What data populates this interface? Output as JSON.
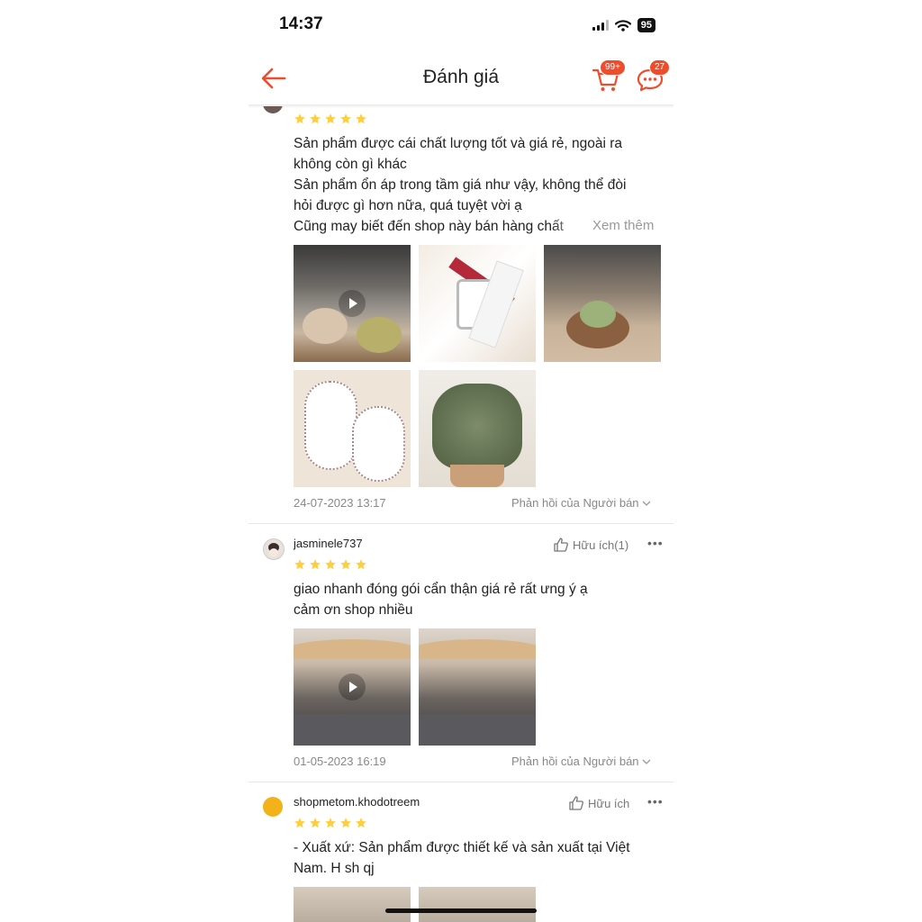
{
  "status_bar": {
    "time": "14:37",
    "battery": "95"
  },
  "header": {
    "title": "Đánh giá",
    "cart_badge": "99+",
    "chat_badge": "27"
  },
  "reviews": [
    {
      "username": "",
      "rating": 5,
      "comment_lines": [
        "Sản phẩm được cái chất lượng tốt và giá rẻ, ngoài ra",
        "không còn gì khác",
        "Sản phẩm ổn áp trong tầm giá như vậy, không thể đòi",
        "hỏi được gì hơn nữa, quá tuyệt vời ạ",
        "Cũng may biết đến shop này bán hàng chất"
      ],
      "see_more": "Xem thêm",
      "photos": [
        "video-dessert",
        "watch",
        "dessert",
        "baby-bibs",
        "pine-tree"
      ],
      "date": "24-07-2023 13:17",
      "seller_reply": "Phản hồi của Người bán"
    },
    {
      "username": "jasminele737",
      "helpful": "Hữu ích(1)",
      "rating": 5,
      "comment_lines": [
        "giao nhanh đóng gói cẩn thận giá rẻ rất ưng ý ạ",
        "cảm ơn shop nhiều"
      ],
      "photos": [
        "video-hanger",
        "hanger"
      ],
      "date": "01-05-2023 16:19",
      "seller_reply": "Phản hồi của Người bán"
    },
    {
      "username": "shopmetom.khodotreem",
      "helpful": "Hữu ích",
      "rating": 5,
      "comment_lines": [
        "- Xuất xứ: Sản phẩm được thiết kế và sản xuất tại Việt",
        "Nam. H sh qj"
      ],
      "photos": [
        "product-1",
        "product-2"
      ]
    }
  ],
  "colors": {
    "accent": "#ee4d2d",
    "star": "#ffce3d"
  }
}
